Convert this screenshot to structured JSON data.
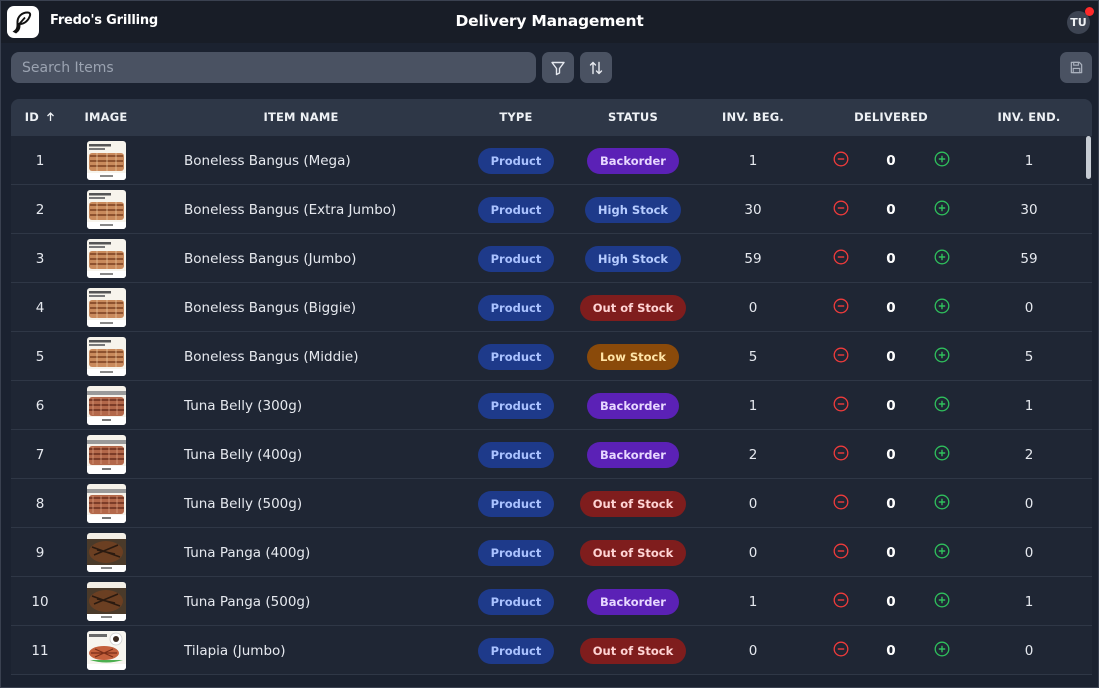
{
  "app": {
    "brand": "Fredo's Grilling",
    "title": "Delivery Management",
    "user_initials": "TU"
  },
  "toolbar": {
    "search_placeholder": "Search Items"
  },
  "columns": {
    "id": "ID",
    "image": "IMAGE",
    "name": "ITEM NAME",
    "type": "TYPE",
    "status": "STATUS",
    "inv_beg": "INV. BEG.",
    "delivered": "DELIVERED",
    "inv_end": "INV. END."
  },
  "status_colors": {
    "Backorder": {
      "bg": "#5b21b6",
      "fg": "#e7d7ff"
    },
    "High Stock": {
      "bg": "#1e3a8a",
      "fg": "#b6ccff"
    },
    "Out of Stock": {
      "bg": "#7f1d1d",
      "fg": "#ffd4d4"
    },
    "Low Stock": {
      "bg": "#8a4a0a",
      "fg": "#ffe4a6"
    }
  },
  "rows": [
    {
      "id": "1",
      "name": "Boneless Bangus (Mega)",
      "type": "Product",
      "status": "Backorder",
      "inv_beg": "1",
      "delivered": "0",
      "inv_end": "1",
      "image": "bangus"
    },
    {
      "id": "2",
      "name": "Boneless Bangus (Extra Jumbo)",
      "type": "Product",
      "status": "High Stock",
      "inv_beg": "30",
      "delivered": "0",
      "inv_end": "30",
      "image": "bangus"
    },
    {
      "id": "3",
      "name": "Boneless Bangus (Jumbo)",
      "type": "Product",
      "status": "High Stock",
      "inv_beg": "59",
      "delivered": "0",
      "inv_end": "59",
      "image": "bangus"
    },
    {
      "id": "4",
      "name": "Boneless Bangus (Biggie)",
      "type": "Product",
      "status": "Out of Stock",
      "inv_beg": "0",
      "delivered": "0",
      "inv_end": "0",
      "image": "bangus"
    },
    {
      "id": "5",
      "name": "Boneless Bangus (Middie)",
      "type": "Product",
      "status": "Low Stock",
      "inv_beg": "5",
      "delivered": "0",
      "inv_end": "5",
      "image": "bangus"
    },
    {
      "id": "6",
      "name": "Tuna Belly (300g)",
      "type": "Product",
      "status": "Backorder",
      "inv_beg": "1",
      "delivered": "0",
      "inv_end": "1",
      "image": "tuna-belly"
    },
    {
      "id": "7",
      "name": "Tuna Belly (400g)",
      "type": "Product",
      "status": "Backorder",
      "inv_beg": "2",
      "delivered": "0",
      "inv_end": "2",
      "image": "tuna-belly"
    },
    {
      "id": "8",
      "name": "Tuna Belly (500g)",
      "type": "Product",
      "status": "Out of Stock",
      "inv_beg": "0",
      "delivered": "0",
      "inv_end": "0",
      "image": "tuna-belly"
    },
    {
      "id": "9",
      "name": "Tuna Panga (400g)",
      "type": "Product",
      "status": "Out of Stock",
      "inv_beg": "0",
      "delivered": "0",
      "inv_end": "0",
      "image": "tuna-panga"
    },
    {
      "id": "10",
      "name": "Tuna Panga (500g)",
      "type": "Product",
      "status": "Backorder",
      "inv_beg": "1",
      "delivered": "0",
      "inv_end": "1",
      "image": "tuna-panga"
    },
    {
      "id": "11",
      "name": "Tilapia (Jumbo)",
      "type": "Product",
      "status": "Out of Stock",
      "inv_beg": "0",
      "delivered": "0",
      "inv_end": "0",
      "image": "tilapia"
    }
  ]
}
